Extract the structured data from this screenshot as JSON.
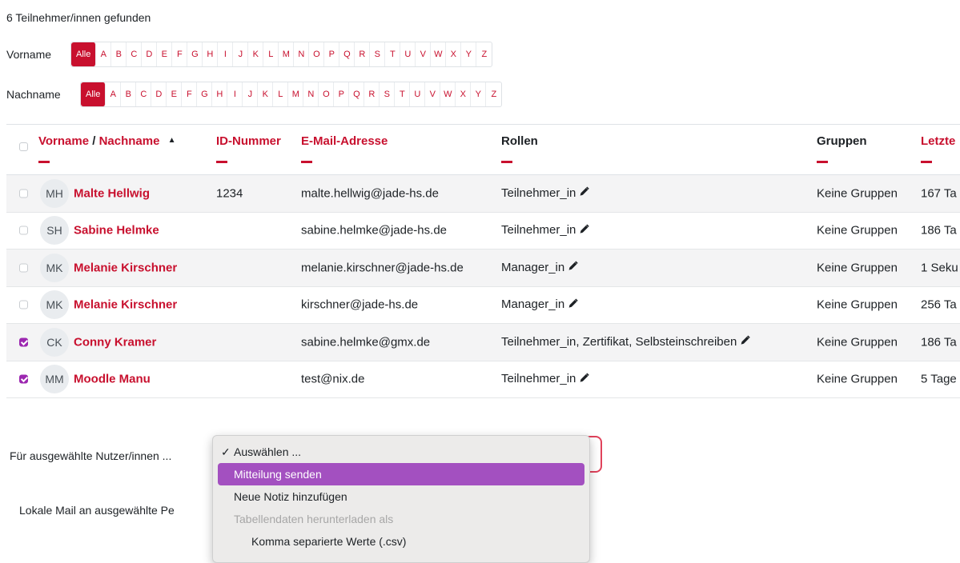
{
  "summary": "6 Teilnehmer/innen gefunden",
  "firstname_filter": {
    "label": "Vorname",
    "letters": [
      "Alle",
      "A",
      "B",
      "C",
      "D",
      "E",
      "F",
      "G",
      "H",
      "I",
      "J",
      "K",
      "L",
      "M",
      "N",
      "O",
      "P",
      "Q",
      "R",
      "S",
      "T",
      "U",
      "V",
      "W",
      "X",
      "Y",
      "Z"
    ],
    "active": "Alle"
  },
  "lastname_filter": {
    "label": "Nachname",
    "letters": [
      "Alle",
      "A",
      "B",
      "C",
      "D",
      "E",
      "F",
      "G",
      "H",
      "I",
      "J",
      "K",
      "L",
      "M",
      "N",
      "O",
      "P",
      "Q",
      "R",
      "S",
      "T",
      "U",
      "V",
      "W",
      "X",
      "Y",
      "Z"
    ],
    "active": "Alle"
  },
  "table": {
    "headers": {
      "firstname": "Vorname",
      "separator": "/",
      "lastname": "Nachname",
      "sort_icon": "caret-up-icon",
      "idnumber": "ID-Nummer",
      "email": "E-Mail-Adresse",
      "roles": "Rollen",
      "groups": "Gruppen",
      "lastaccess": "Letzte"
    },
    "rows": [
      {
        "initials": "MH",
        "name": "Malte Hellwig",
        "id": "1234",
        "email": "malte.hellwig@jade-hs.de",
        "roles": "Teilnehmer_in",
        "groups": "Keine Gruppen",
        "access": "167 Ta",
        "checked": false
      },
      {
        "initials": "SH",
        "name": "Sabine Helmke",
        "id": "",
        "email": "sabine.helmke@jade-hs.de",
        "roles": "Teilnehmer_in",
        "groups": "Keine Gruppen",
        "access": "186 Ta",
        "checked": false
      },
      {
        "initials": "MK",
        "name": "Melanie Kirschner",
        "id": "",
        "email": "melanie.kirschner@jade-hs.de",
        "roles": "Manager_in",
        "groups": "Keine Gruppen",
        "access": "1 Seku",
        "checked": false
      },
      {
        "initials": "MK",
        "name": "Melanie Kirschner",
        "id": "",
        "email": "kirschner@jade-hs.de",
        "roles": "Manager_in",
        "groups": "Keine Gruppen",
        "access": "256 Ta",
        "checked": false
      },
      {
        "initials": "CK",
        "name": "Conny Kramer",
        "id": "",
        "email": "sabine.helmke@gmx.de",
        "roles": "Teilnehmer_in, Zertifikat, Selbsteinschreiben",
        "groups": "Keine Gruppen",
        "access": "186 Ta",
        "checked": true
      },
      {
        "initials": "MM",
        "name": "Moodle Manu",
        "id": "",
        "email": "test@nix.de",
        "roles": "Teilnehmer_in",
        "groups": "Keine Gruppen",
        "access": "5 Tage",
        "checked": true
      }
    ]
  },
  "bulk_label": "Für ausgewählte Nutzer/innen ...",
  "local_mail_label": "Lokale Mail an ausgewählte Pe",
  "dropdown": {
    "options": [
      {
        "label": "Auswählen ...",
        "type": "selected"
      },
      {
        "label": "Mitteilung senden",
        "type": "highlight"
      },
      {
        "label": "Neue Notiz hinzufügen",
        "type": "normal"
      },
      {
        "label": "Tabellendaten herunterladen als",
        "type": "group"
      },
      {
        "label": "Komma separierte Werte (.csv)",
        "type": "indent"
      }
    ]
  },
  "colors": {
    "accent": "#c8102e",
    "highlight": "#a350c0",
    "checkbox": "#9c27b0"
  }
}
